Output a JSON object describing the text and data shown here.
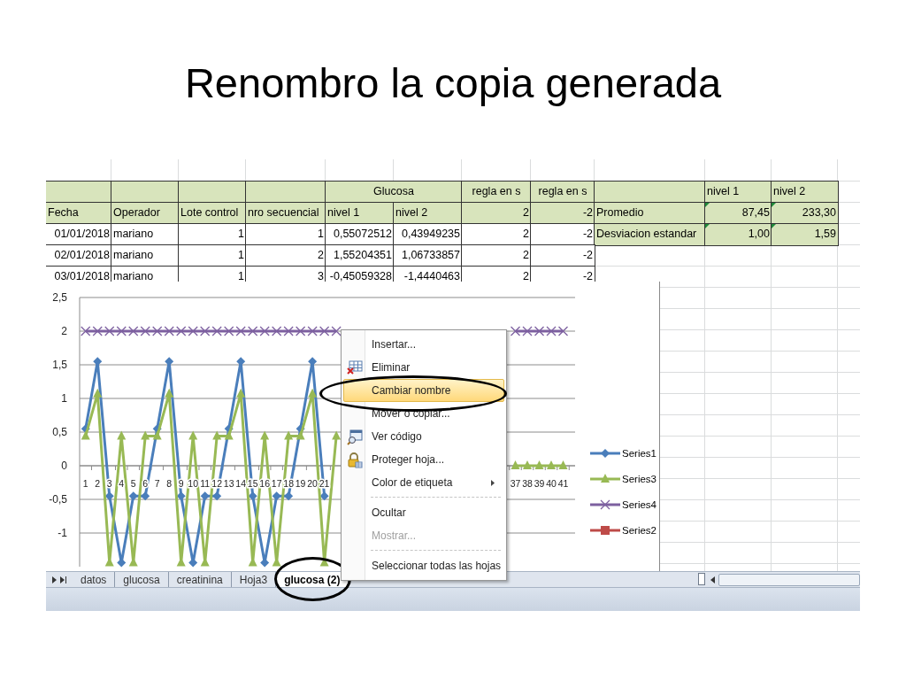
{
  "slide_title": "Renombro la copia generada",
  "sheet": {
    "rows": [
      {
        "cells": [
          {
            "kind": "text",
            "shaded": true,
            "flagged": false
          },
          {
            "kind": "text",
            "shaded": true,
            "flagged": false
          },
          {
            "kind": "text",
            "shaded": true,
            "flagged": false
          },
          {
            "kind": "text",
            "shaded": true,
            "flagged": false
          },
          {
            "text": "Glucosa",
            "kind": "center",
            "merged": true,
            "shaded": true,
            "flagged": false
          },
          {
            "text": "regla en s",
            "kind": "center",
            "shaded": true,
            "flagged": false
          },
          {
            "text": "regla en s",
            "kind": "center",
            "shaded": true,
            "flagged": false
          },
          {
            "kind": "text",
            "shaded": true,
            "flagged": false
          },
          {
            "text": "nivel 1",
            "kind": "text",
            "shaded": true,
            "flagged": false
          },
          {
            "text": "nivel 2",
            "kind": "text",
            "shaded": true,
            "flagged": false
          }
        ]
      },
      {
        "cells": [
          {
            "text": "Fecha",
            "kind": "text",
            "shaded": true,
            "flagged": false
          },
          {
            "text": "Operador",
            "kind": "text",
            "shaded": true,
            "flagged": false
          },
          {
            "text": "Lote control",
            "kind": "text",
            "shaded": true,
            "flagged": false
          },
          {
            "text": "nro secuencial",
            "kind": "text",
            "shaded": true,
            "flagged": false
          },
          {
            "text": "nivel 1",
            "kind": "text",
            "shaded": true,
            "flagged": false
          },
          {
            "text": "nivel 2",
            "kind": "text",
            "shaded": true,
            "flagged": false
          },
          {
            "text": "2",
            "kind": "number",
            "shaded": true,
            "flagged": false
          },
          {
            "text": "-2",
            "kind": "number",
            "shaded": true,
            "flagged": false
          },
          {
            "text": "Promedio",
            "kind": "text",
            "shaded": true,
            "flagged": false
          },
          {
            "text": "87,45",
            "kind": "number",
            "shaded": true,
            "flagged": true
          },
          {
            "text": "233,30",
            "kind": "number",
            "shaded": true,
            "flagged": true
          }
        ]
      },
      {
        "cells": [
          {
            "text": "01/01/2018",
            "kind": "number",
            "shaded": false,
            "flagged": false
          },
          {
            "text": "mariano",
            "kind": "text",
            "shaded": false,
            "flagged": false
          },
          {
            "text": "1",
            "kind": "number",
            "shaded": false,
            "flagged": false
          },
          {
            "text": "1",
            "kind": "number",
            "shaded": false,
            "flagged": false
          },
          {
            "text": "0,55072512",
            "kind": "number",
            "shaded": false,
            "flagged": false
          },
          {
            "text": "0,43949235",
            "kind": "number",
            "shaded": false,
            "flagged": false
          },
          {
            "text": "2",
            "kind": "number",
            "shaded": false,
            "flagged": false
          },
          {
            "text": "-2",
            "kind": "number",
            "shaded": false,
            "flagged": false
          },
          {
            "text": "Desviacion estandar",
            "kind": "text",
            "shaded": true,
            "flagged": false
          },
          {
            "text": "1,00",
            "kind": "number",
            "shaded": true,
            "flagged": true
          },
          {
            "text": "1,59",
            "kind": "number",
            "shaded": true,
            "flagged": true
          }
        ]
      },
      {
        "cells": [
          {
            "text": "02/01/2018",
            "kind": "number",
            "shaded": false,
            "flagged": false
          },
          {
            "text": "mariano",
            "kind": "text",
            "shaded": false,
            "flagged": false
          },
          {
            "text": "1",
            "kind": "number",
            "shaded": false,
            "flagged": false
          },
          {
            "text": "2",
            "kind": "number",
            "shaded": false,
            "flagged": false
          },
          {
            "text": "1,55204351",
            "kind": "number",
            "shaded": false,
            "flagged": false
          },
          {
            "text": "1,06733857",
            "kind": "number",
            "shaded": false,
            "flagged": false
          },
          {
            "text": "2",
            "kind": "number",
            "shaded": false,
            "flagged": false
          },
          {
            "text": "-2",
            "kind": "number",
            "shaded": false,
            "flagged": false
          }
        ]
      },
      {
        "cells": [
          {
            "text": "03/01/2018",
            "kind": "number",
            "shaded": false,
            "flagged": false
          },
          {
            "text": "mariano",
            "kind": "text",
            "shaded": false,
            "flagged": false
          },
          {
            "text": "1",
            "kind": "number",
            "shaded": false,
            "flagged": false
          },
          {
            "text": "3",
            "kind": "number",
            "shaded": false,
            "flagged": false
          },
          {
            "text": "-0,45059328",
            "kind": "number",
            "shaded": false,
            "flagged": false
          },
          {
            "text": "-1,4440463",
            "kind": "number",
            "shaded": false,
            "flagged": false
          },
          {
            "text": "2",
            "kind": "number",
            "shaded": false,
            "flagged": false
          },
          {
            "text": "-2",
            "kind": "number",
            "shaded": false,
            "flagged": false
          }
        ]
      }
    ]
  },
  "chart": {
    "chart_data": {
      "type": "line",
      "x": [
        1,
        2,
        3,
        4,
        5,
        6,
        7,
        8,
        9,
        10,
        11,
        12,
        13,
        14,
        15,
        16,
        17,
        18,
        19,
        20,
        21,
        22,
        23,
        24,
        25,
        26,
        27,
        28,
        29,
        30,
        31,
        32,
        33,
        34,
        35,
        36,
        37,
        38,
        39,
        40,
        41
      ],
      "xticks": [
        1,
        2,
        3,
        4,
        5,
        6,
        7,
        8,
        9,
        10,
        11,
        12,
        13,
        14,
        15,
        16,
        17,
        18,
        19,
        20,
        21,
        37,
        38,
        39,
        40,
        41
      ],
      "grid": true,
      "xlim": [
        0.5,
        42
      ],
      "ylim": [
        -1.5,
        2.5
      ],
      "yticks": [
        {
          "value": 2.5,
          "label": "2,5"
        },
        {
          "value": 2,
          "label": "2"
        },
        {
          "value": 1.5,
          "label": "1,5"
        },
        {
          "value": 1,
          "label": "1"
        },
        {
          "value": 0.5,
          "label": "0,5"
        },
        {
          "value": 0,
          "label": "0"
        },
        {
          "value": -0.5,
          "label": "-0,5"
        },
        {
          "value": -1,
          "label": "-1"
        }
      ],
      "series": [
        {
          "name": "Series1",
          "color": "#4a7ebb",
          "marker": "diamond",
          "values": [
            0.55,
            1.55,
            -0.45,
            -1.44,
            -0.45,
            -0.45,
            0.55,
            1.55,
            -0.45,
            -1.44,
            -0.45,
            -0.45,
            0.55,
            1.55,
            -0.45,
            -1.44,
            -0.45,
            -0.45,
            0.55,
            1.55,
            -0.45,
            null,
            null,
            null,
            null,
            null,
            null,
            null,
            null,
            null,
            null,
            null,
            null,
            null,
            null,
            null,
            null,
            null,
            null,
            null,
            null
          ]
        },
        {
          "name": "Series3",
          "color": "#98b954",
          "marker": "triangle",
          "values": [
            0.44,
            1.07,
            -1.44,
            0.44,
            -1.44,
            0.44,
            0.44,
            1.07,
            -1.44,
            0.44,
            -1.44,
            0.44,
            0.44,
            1.07,
            -1.44,
            0.44,
            -1.44,
            0.44,
            0.44,
            1.07,
            -1.44,
            0.44,
            null,
            null,
            null,
            null,
            null,
            null,
            null,
            null,
            null,
            null,
            null,
            null,
            null,
            null,
            0,
            0,
            0,
            0,
            0
          ]
        },
        {
          "name": "Series4",
          "color": "#7d60a0",
          "marker": "cross",
          "values": [
            2,
            2,
            2,
            2,
            2,
            2,
            2,
            2,
            2,
            2,
            2,
            2,
            2,
            2,
            2,
            2,
            2,
            2,
            2,
            2,
            2,
            2,
            null,
            null,
            null,
            null,
            null,
            null,
            null,
            null,
            null,
            null,
            null,
            null,
            null,
            null,
            2,
            2,
            2,
            2,
            2
          ]
        },
        {
          "name": "Series2",
          "color": "#be4b48",
          "marker": "square",
          "values": [
            null,
            null,
            null,
            null,
            null,
            null,
            null,
            null,
            null,
            null,
            null,
            null,
            null,
            null,
            null,
            null,
            null,
            null,
            null,
            null,
            null,
            null,
            null,
            null,
            null,
            null,
            null,
            null,
            null,
            null,
            null,
            null,
            null,
            null,
            null,
            null,
            null,
            null,
            null,
            null,
            null
          ]
        }
      ]
    }
  },
  "context_menu": {
    "items": [
      {
        "kind": "item",
        "label": "Insertar...",
        "selected": false,
        "disabled": false,
        "submenu": false,
        "circled": false
      },
      {
        "kind": "item",
        "label": "Eliminar",
        "selected": false,
        "disabled": false,
        "submenu": false,
        "circled": false
      },
      {
        "kind": "item",
        "label": "Cambiar nombre",
        "selected": true,
        "disabled": false,
        "submenu": false,
        "circled": true
      },
      {
        "kind": "item",
        "label": "Mover o copiar...",
        "selected": false,
        "disabled": false,
        "submenu": false,
        "circled": false
      },
      {
        "kind": "item",
        "label": "Ver código",
        "selected": false,
        "disabled": false,
        "submenu": false,
        "circled": false
      },
      {
        "kind": "item",
        "label": "Proteger hoja...",
        "selected": false,
        "disabled": false,
        "submenu": false,
        "circled": false
      },
      {
        "kind": "item",
        "label": "Color de etiqueta",
        "selected": false,
        "disabled": false,
        "submenu": true,
        "circled": false
      },
      {
        "kind": "separator"
      },
      {
        "kind": "item",
        "label": "Ocultar",
        "selected": false,
        "disabled": false,
        "submenu": false,
        "circled": false
      },
      {
        "kind": "item",
        "label": "Mostrar...",
        "selected": false,
        "disabled": true,
        "submenu": false,
        "circled": false
      },
      {
        "kind": "separator"
      },
      {
        "kind": "item",
        "label": "Seleccionar todas las hojas",
        "selected": false,
        "disabled": false,
        "submenu": false,
        "circled": false
      }
    ]
  },
  "sheet_tabs": [
    {
      "label": "datos",
      "selected": false,
      "circled": false
    },
    {
      "label": "glucosa",
      "selected": false,
      "circled": false
    },
    {
      "label": "creatinina",
      "selected": false,
      "circled": false
    },
    {
      "label": "Hoja3",
      "selected": false,
      "circled": false
    },
    {
      "label": "glucosa (2)",
      "selected": true,
      "circled": true
    }
  ]
}
